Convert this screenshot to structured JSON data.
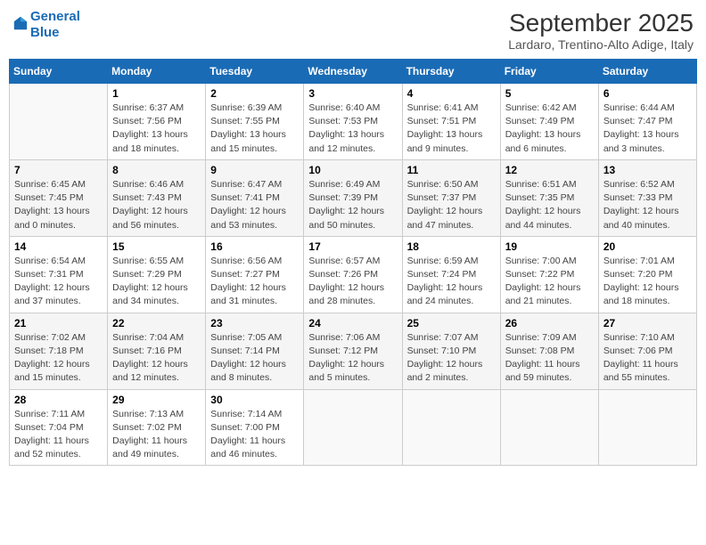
{
  "header": {
    "logo_line1": "General",
    "logo_line2": "Blue",
    "title": "September 2025",
    "subtitle": "Lardaro, Trentino-Alto Adige, Italy"
  },
  "days_of_week": [
    "Sunday",
    "Monday",
    "Tuesday",
    "Wednesday",
    "Thursday",
    "Friday",
    "Saturday"
  ],
  "weeks": [
    [
      {
        "number": "",
        "sunrise": "",
        "sunset": "",
        "daylight": ""
      },
      {
        "number": "1",
        "sunrise": "Sunrise: 6:37 AM",
        "sunset": "Sunset: 7:56 PM",
        "daylight": "Daylight: 13 hours and 18 minutes."
      },
      {
        "number": "2",
        "sunrise": "Sunrise: 6:39 AM",
        "sunset": "Sunset: 7:55 PM",
        "daylight": "Daylight: 13 hours and 15 minutes."
      },
      {
        "number": "3",
        "sunrise": "Sunrise: 6:40 AM",
        "sunset": "Sunset: 7:53 PM",
        "daylight": "Daylight: 13 hours and 12 minutes."
      },
      {
        "number": "4",
        "sunrise": "Sunrise: 6:41 AM",
        "sunset": "Sunset: 7:51 PM",
        "daylight": "Daylight: 13 hours and 9 minutes."
      },
      {
        "number": "5",
        "sunrise": "Sunrise: 6:42 AM",
        "sunset": "Sunset: 7:49 PM",
        "daylight": "Daylight: 13 hours and 6 minutes."
      },
      {
        "number": "6",
        "sunrise": "Sunrise: 6:44 AM",
        "sunset": "Sunset: 7:47 PM",
        "daylight": "Daylight: 13 hours and 3 minutes."
      }
    ],
    [
      {
        "number": "7",
        "sunrise": "Sunrise: 6:45 AM",
        "sunset": "Sunset: 7:45 PM",
        "daylight": "Daylight: 13 hours and 0 minutes."
      },
      {
        "number": "8",
        "sunrise": "Sunrise: 6:46 AM",
        "sunset": "Sunset: 7:43 PM",
        "daylight": "Daylight: 12 hours and 56 minutes."
      },
      {
        "number": "9",
        "sunrise": "Sunrise: 6:47 AM",
        "sunset": "Sunset: 7:41 PM",
        "daylight": "Daylight: 12 hours and 53 minutes."
      },
      {
        "number": "10",
        "sunrise": "Sunrise: 6:49 AM",
        "sunset": "Sunset: 7:39 PM",
        "daylight": "Daylight: 12 hours and 50 minutes."
      },
      {
        "number": "11",
        "sunrise": "Sunrise: 6:50 AM",
        "sunset": "Sunset: 7:37 PM",
        "daylight": "Daylight: 12 hours and 47 minutes."
      },
      {
        "number": "12",
        "sunrise": "Sunrise: 6:51 AM",
        "sunset": "Sunset: 7:35 PM",
        "daylight": "Daylight: 12 hours and 44 minutes."
      },
      {
        "number": "13",
        "sunrise": "Sunrise: 6:52 AM",
        "sunset": "Sunset: 7:33 PM",
        "daylight": "Daylight: 12 hours and 40 minutes."
      }
    ],
    [
      {
        "number": "14",
        "sunrise": "Sunrise: 6:54 AM",
        "sunset": "Sunset: 7:31 PM",
        "daylight": "Daylight: 12 hours and 37 minutes."
      },
      {
        "number": "15",
        "sunrise": "Sunrise: 6:55 AM",
        "sunset": "Sunset: 7:29 PM",
        "daylight": "Daylight: 12 hours and 34 minutes."
      },
      {
        "number": "16",
        "sunrise": "Sunrise: 6:56 AM",
        "sunset": "Sunset: 7:27 PM",
        "daylight": "Daylight: 12 hours and 31 minutes."
      },
      {
        "number": "17",
        "sunrise": "Sunrise: 6:57 AM",
        "sunset": "Sunset: 7:26 PM",
        "daylight": "Daylight: 12 hours and 28 minutes."
      },
      {
        "number": "18",
        "sunrise": "Sunrise: 6:59 AM",
        "sunset": "Sunset: 7:24 PM",
        "daylight": "Daylight: 12 hours and 24 minutes."
      },
      {
        "number": "19",
        "sunrise": "Sunrise: 7:00 AM",
        "sunset": "Sunset: 7:22 PM",
        "daylight": "Daylight: 12 hours and 21 minutes."
      },
      {
        "number": "20",
        "sunrise": "Sunrise: 7:01 AM",
        "sunset": "Sunset: 7:20 PM",
        "daylight": "Daylight: 12 hours and 18 minutes."
      }
    ],
    [
      {
        "number": "21",
        "sunrise": "Sunrise: 7:02 AM",
        "sunset": "Sunset: 7:18 PM",
        "daylight": "Daylight: 12 hours and 15 minutes."
      },
      {
        "number": "22",
        "sunrise": "Sunrise: 7:04 AM",
        "sunset": "Sunset: 7:16 PM",
        "daylight": "Daylight: 12 hours and 12 minutes."
      },
      {
        "number": "23",
        "sunrise": "Sunrise: 7:05 AM",
        "sunset": "Sunset: 7:14 PM",
        "daylight": "Daylight: 12 hours and 8 minutes."
      },
      {
        "number": "24",
        "sunrise": "Sunrise: 7:06 AM",
        "sunset": "Sunset: 7:12 PM",
        "daylight": "Daylight: 12 hours and 5 minutes."
      },
      {
        "number": "25",
        "sunrise": "Sunrise: 7:07 AM",
        "sunset": "Sunset: 7:10 PM",
        "daylight": "Daylight: 12 hours and 2 minutes."
      },
      {
        "number": "26",
        "sunrise": "Sunrise: 7:09 AM",
        "sunset": "Sunset: 7:08 PM",
        "daylight": "Daylight: 11 hours and 59 minutes."
      },
      {
        "number": "27",
        "sunrise": "Sunrise: 7:10 AM",
        "sunset": "Sunset: 7:06 PM",
        "daylight": "Daylight: 11 hours and 55 minutes."
      }
    ],
    [
      {
        "number": "28",
        "sunrise": "Sunrise: 7:11 AM",
        "sunset": "Sunset: 7:04 PM",
        "daylight": "Daylight: 11 hours and 52 minutes."
      },
      {
        "number": "29",
        "sunrise": "Sunrise: 7:13 AM",
        "sunset": "Sunset: 7:02 PM",
        "daylight": "Daylight: 11 hours and 49 minutes."
      },
      {
        "number": "30",
        "sunrise": "Sunrise: 7:14 AM",
        "sunset": "Sunset: 7:00 PM",
        "daylight": "Daylight: 11 hours and 46 minutes."
      },
      {
        "number": "",
        "sunrise": "",
        "sunset": "",
        "daylight": ""
      },
      {
        "number": "",
        "sunrise": "",
        "sunset": "",
        "daylight": ""
      },
      {
        "number": "",
        "sunrise": "",
        "sunset": "",
        "daylight": ""
      },
      {
        "number": "",
        "sunrise": "",
        "sunset": "",
        "daylight": ""
      }
    ]
  ]
}
